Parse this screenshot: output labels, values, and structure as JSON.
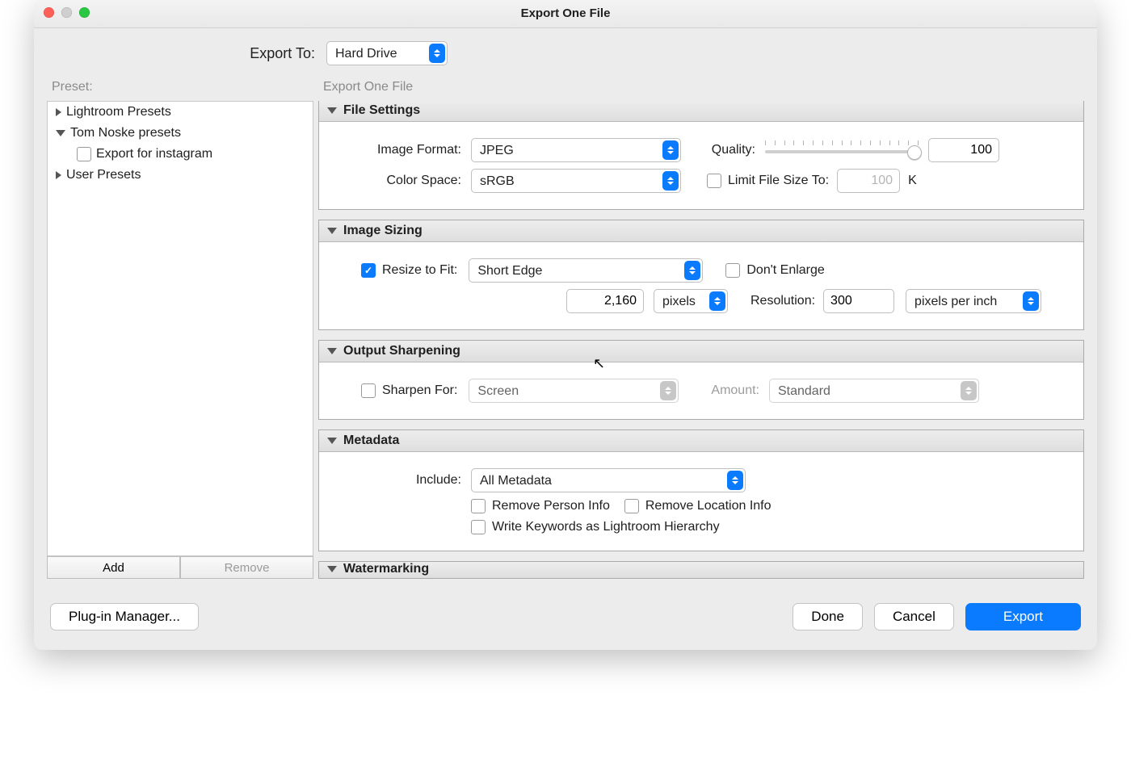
{
  "window": {
    "title": "Export One File"
  },
  "toprow": {
    "label": "Export To:",
    "value": "Hard Drive"
  },
  "sidebar": {
    "heading": "Preset:",
    "groups": [
      {
        "label": "Lightroom Presets",
        "expanded": false
      },
      {
        "label": "Tom Noske presets",
        "expanded": true,
        "children": [
          {
            "label": "Export for instagram",
            "checked": false
          }
        ]
      },
      {
        "label": "User Presets",
        "expanded": false
      }
    ],
    "add": "Add",
    "remove": "Remove"
  },
  "main": {
    "heading": "Export One File",
    "panels": {
      "file_settings": {
        "title": "File Settings",
        "image_format_label": "Image Format:",
        "image_format": "JPEG",
        "quality_label": "Quality:",
        "quality_value": "100",
        "quality_percent": 100,
        "color_space_label": "Color Space:",
        "color_space": "sRGB",
        "limit_label": "Limit File Size To:",
        "limit_checked": false,
        "limit_value": "100",
        "limit_unit": "K"
      },
      "image_sizing": {
        "title": "Image Sizing",
        "resize_label": "Resize to Fit:",
        "resize_checked": true,
        "fit_mode": "Short Edge",
        "dont_enlarge_label": "Don't Enlarge",
        "dont_enlarge_checked": false,
        "size_value": "2,160",
        "size_unit": "pixels",
        "resolution_label": "Resolution:",
        "resolution_value": "300",
        "resolution_unit": "pixels per inch"
      },
      "output_sharpening": {
        "title": "Output Sharpening",
        "sharpen_label": "Sharpen For:",
        "sharpen_checked": false,
        "sharpen_target": "Screen",
        "amount_label": "Amount:",
        "amount_value": "Standard"
      },
      "metadata": {
        "title": "Metadata",
        "include_label": "Include:",
        "include_value": "All Metadata",
        "remove_person": "Remove Person Info",
        "remove_location": "Remove Location Info",
        "write_keywords": "Write Keywords as Lightroom Hierarchy"
      },
      "watermarking": {
        "title": "Watermarking"
      }
    }
  },
  "footer": {
    "plugins": "Plug-in Manager...",
    "done": "Done",
    "cancel": "Cancel",
    "export": "Export"
  }
}
